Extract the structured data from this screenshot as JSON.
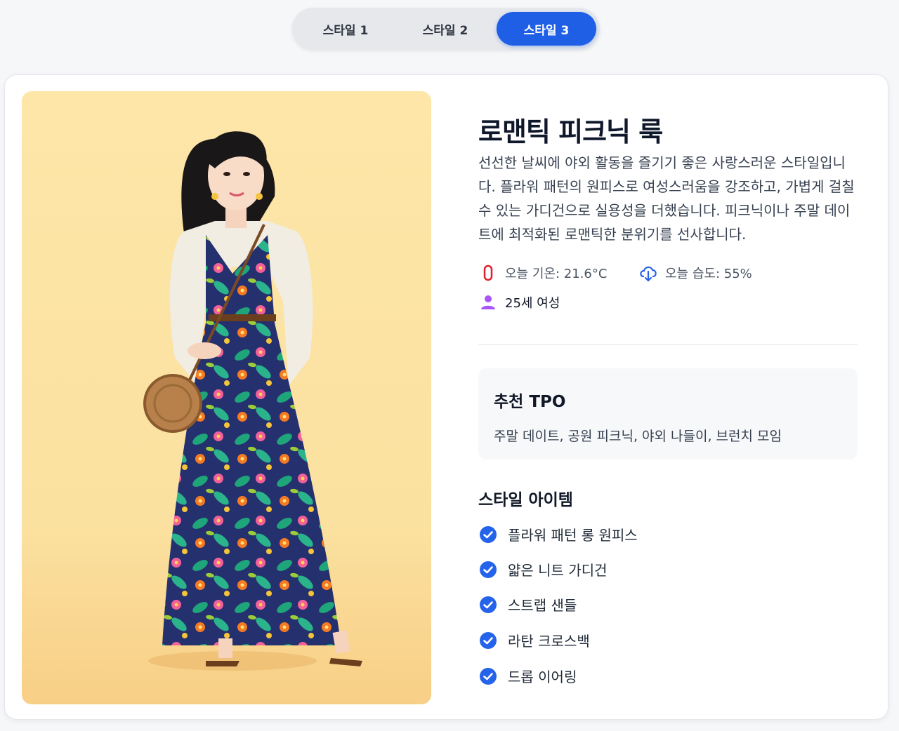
{
  "tabs": [
    {
      "label": "스타일 1"
    },
    {
      "label": "스타일 2"
    },
    {
      "label": "스타일 3"
    }
  ],
  "style": {
    "title": "로맨틱 피크닉 룩",
    "description": "선선한 날씨에 야외 활동을 즐기기 좋은 사랑스러운 스타일입니다. 플라워 패턴의 원피스로 여성스러움을 강조하고, 가볍게 걸칠 수 있는 가디건으로 실용성을 더했습니다. 피크닉이나 주말 데이트에 최적화된 로맨틱한 분위기를 선사합니다.",
    "temperature": "오늘 기온: 21.6°C",
    "humidity": "오늘 습도: 55%",
    "persona": "25세 여성"
  },
  "tpo": {
    "title": "추천 TPO",
    "text": "주말 데이트, 공원 피크닉, 야외 나들이, 브런치 모임"
  },
  "items": {
    "title": "스타일 아이템",
    "list": [
      {
        "label": "플라워 패턴 롱 원피스"
      },
      {
        "label": "얇은 니트 가디건"
      },
      {
        "label": "스트랩 샌들"
      },
      {
        "label": "라탄 크로스백"
      },
      {
        "label": "드롭 이어링"
      }
    ]
  },
  "colors": {
    "accent": "#1f5fe6",
    "temp_icon": "#e11d2f",
    "humidity_icon": "#2563eb",
    "persona_icon": "#a855f7",
    "check": "#2563eb"
  }
}
